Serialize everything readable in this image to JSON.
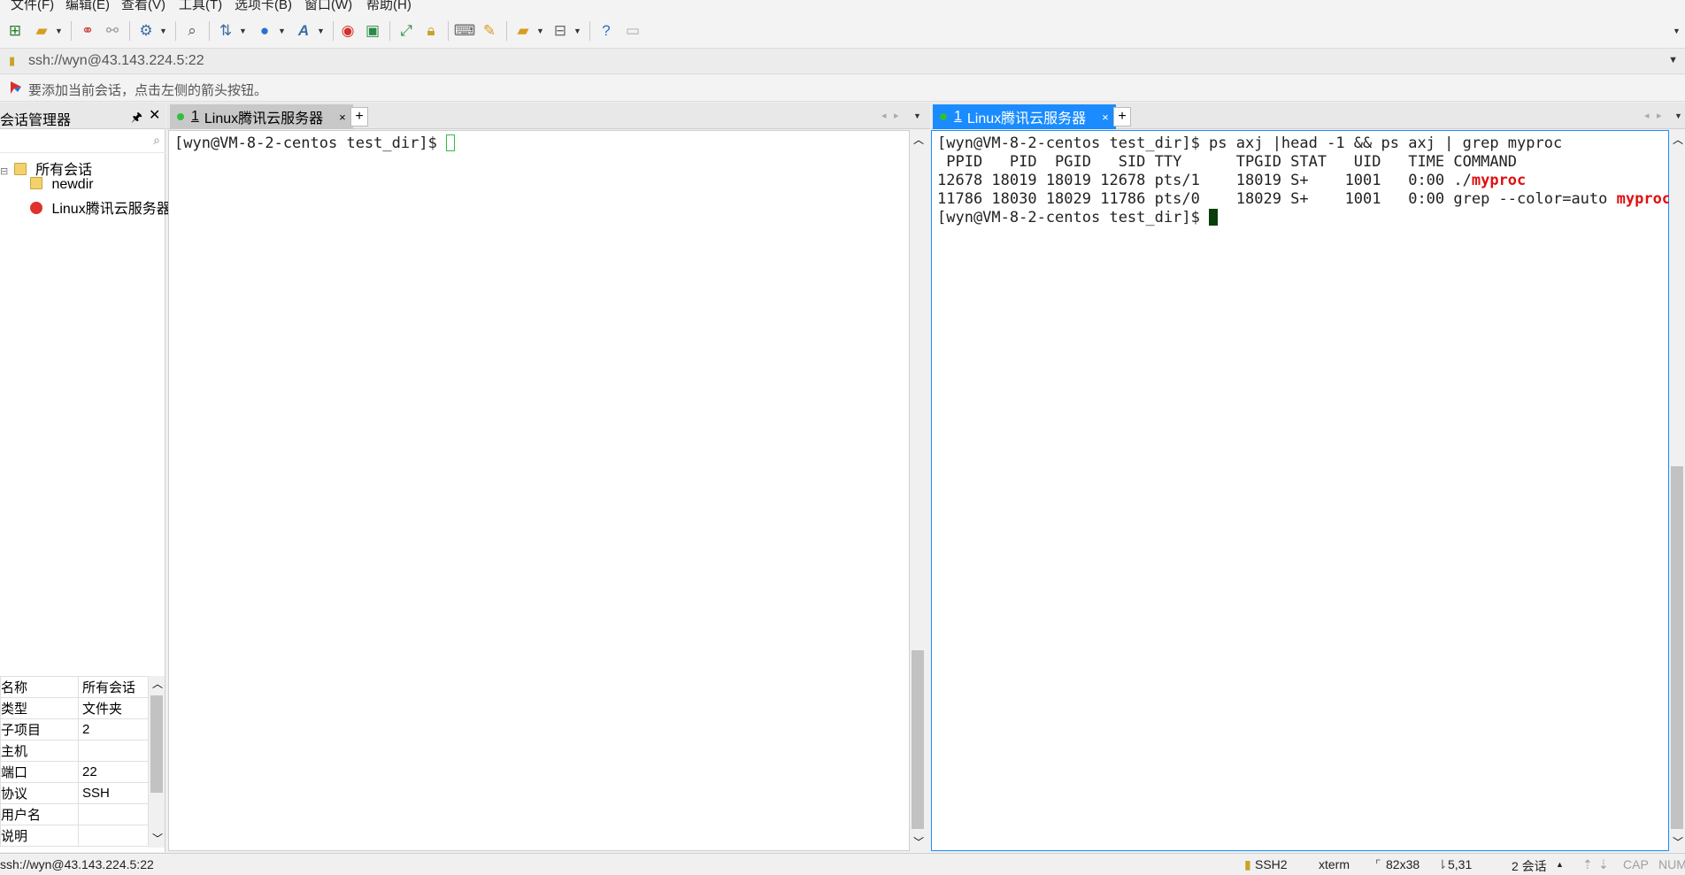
{
  "menu": [
    "文件(F)",
    "编辑(E)",
    "查看(V)",
    "工具(T)",
    "选项卡(B)",
    "窗口(W)",
    "帮助(H)"
  ],
  "address": {
    "value": "ssh://wyn@43.143.224.5:22"
  },
  "hint": "要添加当前会话，点击左侧的箭头按钮。",
  "session_manager": {
    "title": "会话管理器",
    "pin_glyph": "🖈",
    "close_glyph": "✕",
    "tree": {
      "root": "所有会话",
      "children": [
        "newdir",
        "Linux腾讯云服务器"
      ]
    },
    "properties": [
      {
        "key": "名称",
        "value": "所有会话"
      },
      {
        "key": "类型",
        "value": "文件夹"
      },
      {
        "key": "子项目",
        "value": "2"
      },
      {
        "key": "主机",
        "value": ""
      },
      {
        "key": "端口",
        "value": "22"
      },
      {
        "key": "协议",
        "value": "SSH"
      },
      {
        "key": "用户名",
        "value": ""
      },
      {
        "key": "说明",
        "value": ""
      }
    ]
  },
  "tabs_left": [
    {
      "num": "1",
      "label": "Linux腾讯云服务器",
      "active": false
    }
  ],
  "tabs_right": [
    {
      "num": "1",
      "label": "Linux腾讯云服务器",
      "active": true
    }
  ],
  "tab_close_glyph": "×",
  "tab_add_glyph": "+",
  "terminal_left": {
    "prompt": "[wyn@VM-8-2-centos test_dir]$ "
  },
  "terminal_right": {
    "lines": [
      {
        "text": "[wyn@VM-8-2-centos test_dir]$ ps axj |head -1 && ps axj | grep myproc",
        "highlight": ""
      },
      {
        "text": " PPID   PID  PGID   SID TTY      TPGID STAT   UID   TIME COMMAND",
        "highlight": ""
      },
      {
        "text": "12678 18019 18019 12678 pts/1    18019 S+    1001   0:00 ./",
        "highlight": "myproc"
      },
      {
        "text": "11786 18030 18029 11786 pts/0    18029 S+    1001   0:00 grep --color=auto ",
        "highlight": "myproc"
      }
    ],
    "prompt": "[wyn@VM-8-2-centos test_dir]$ "
  },
  "status": {
    "address": "ssh://wyn@43.143.224.5:22",
    "protocol": "SSH2",
    "term": "xterm",
    "size": "82x38",
    "cursor_pos": "5,31",
    "sessions": "2 会话",
    "cap": "CAP",
    "num": "NUM"
  },
  "colors": {
    "accent": "#1a8cff",
    "highlight": "#e01010",
    "session_dot": "#2fbf3d"
  }
}
